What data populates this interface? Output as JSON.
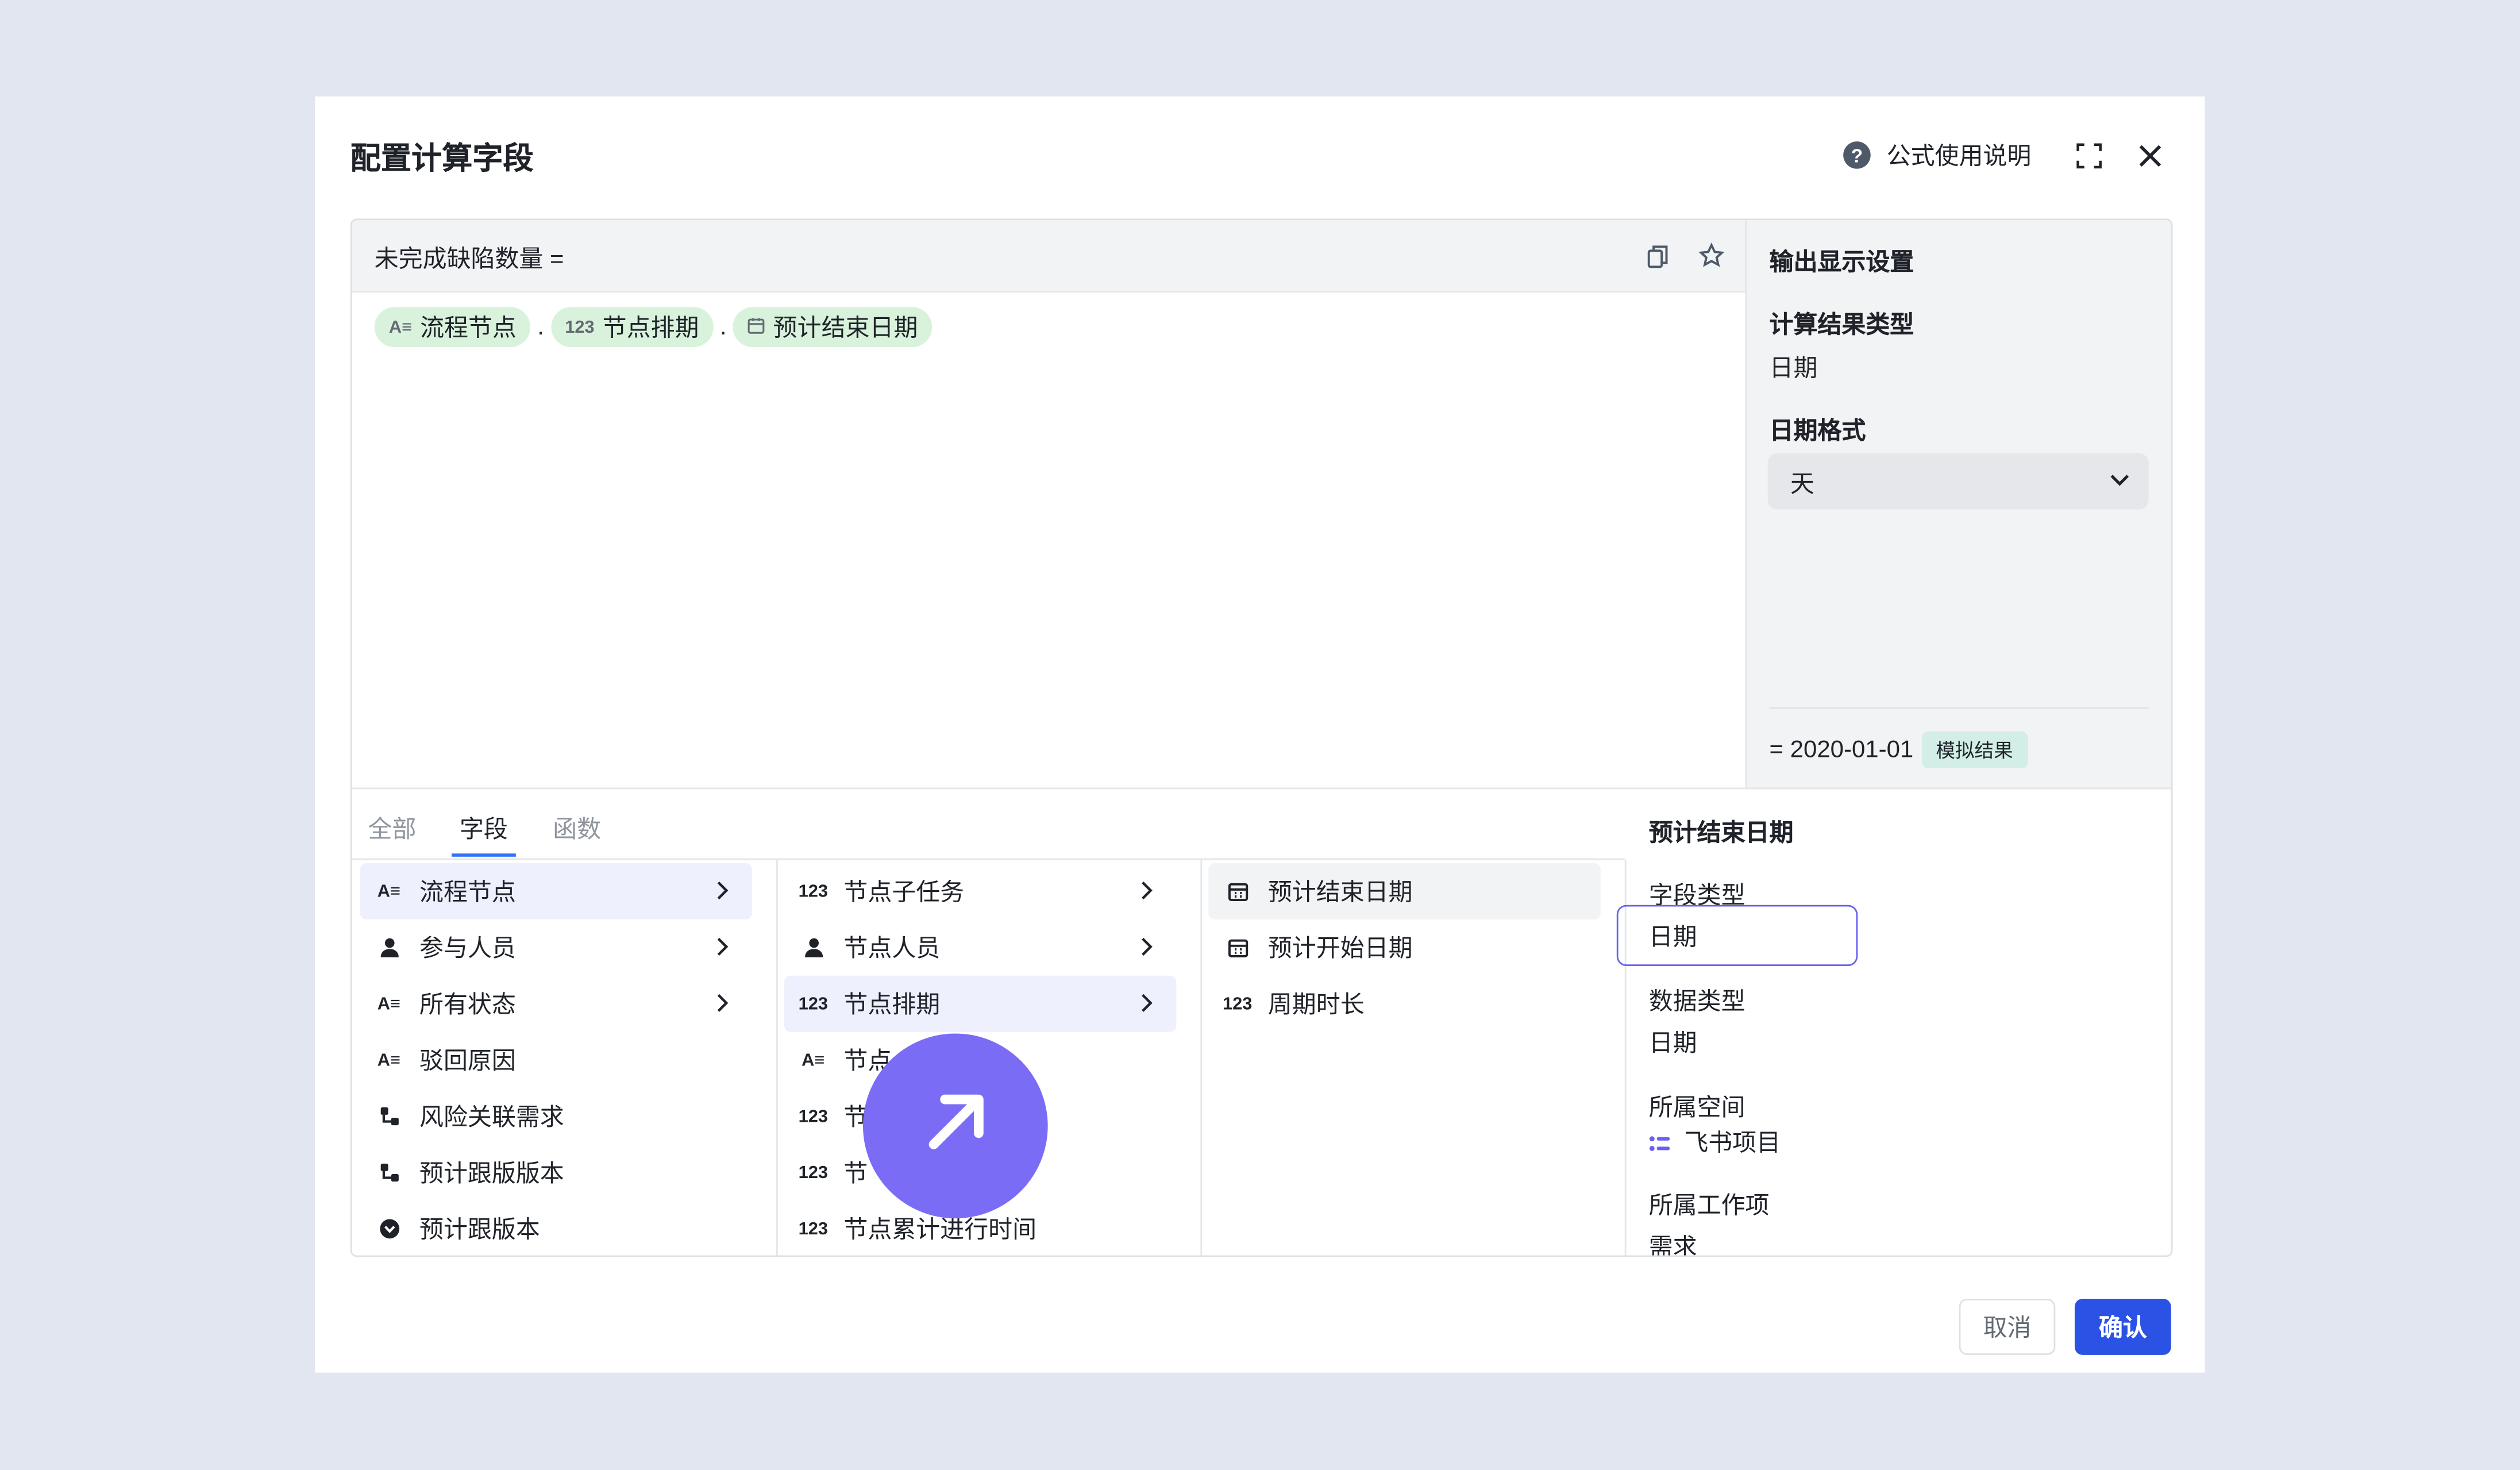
{
  "dialog": {
    "title": "配置计算字段",
    "help_label": "公式使用说明",
    "icons": [
      "help-icon",
      "fullscreen-icon",
      "close-icon"
    ]
  },
  "editor": {
    "formula_name": "未完成缺陷数量 =",
    "tokens": [
      {
        "icon": "Aa",
        "label": "流程节点"
      },
      {
        "icon": "123",
        "label": "节点排期"
      },
      {
        "icon": "calendar",
        "label": "预计结束日期"
      }
    ],
    "separator": "."
  },
  "output": {
    "title": "输出显示设置",
    "result_type_label": "计算结果类型",
    "result_type_value": "日期",
    "date_format_label": "日期格式",
    "date_format_value": "天",
    "result_value": "= 2020-01-01",
    "simulated_badge": "模拟结果"
  },
  "tabs": [
    {
      "label": "全部"
    },
    {
      "label": "字段"
    },
    {
      "label": "函数"
    }
  ],
  "active_tab": "字段",
  "columns": {
    "col1": [
      {
        "icon": "Aa",
        "label": "流程节点",
        "arrow": true
      },
      {
        "icon": "person",
        "label": "参与人员",
        "arrow": true
      },
      {
        "icon": "Aa",
        "label": "所有状态",
        "arrow": true
      },
      {
        "icon": "Aa",
        "label": "驳回原因",
        "arrow": false
      },
      {
        "icon": "link",
        "label": "风险关联需求",
        "arrow": false
      },
      {
        "icon": "link",
        "label": "预计跟版版本",
        "arrow": false
      },
      {
        "icon": "circle-down",
        "label": "预计跟版本",
        "arrow": false
      }
    ],
    "col2": [
      {
        "icon": "123",
        "label": "节点子任务",
        "arrow": true
      },
      {
        "icon": "person",
        "label": "节点人员",
        "arrow": true
      },
      {
        "icon": "123",
        "label": "节点排期",
        "arrow": true
      },
      {
        "icon": "Aa",
        "label": "节点",
        "arrow": false
      },
      {
        "icon": "123",
        "label": "节",
        "arrow": false
      },
      {
        "icon": "123",
        "label": "节",
        "arrow": false
      },
      {
        "icon": "123",
        "label": "节点累计进行时间",
        "arrow": false
      }
    ],
    "col3": [
      {
        "icon": "calendar",
        "label": "预计结束日期"
      },
      {
        "icon": "calendar",
        "label": "预计开始日期"
      },
      {
        "icon": "123",
        "label": "周期时长"
      }
    ]
  },
  "field_info": {
    "title": "预计结束日期",
    "field_type_label": "字段类型",
    "field_type_value": "日期",
    "data_type_label": "数据类型",
    "data_type_value": "日期",
    "space_label": "所属空间",
    "space_value": "飞书项目",
    "work_item_label": "所属工作项",
    "work_item_value": "需求"
  },
  "footer": {
    "cancel_label": "取消",
    "ok_label": "确认"
  },
  "colors": {
    "primary": "#2a52e4",
    "token_bg": "#d9f2dc",
    "badge_bg": "#d2eee6",
    "fab": "#7b6cf6",
    "selected_row": "#eef0fd",
    "highlight_border": "#6a61ee"
  }
}
